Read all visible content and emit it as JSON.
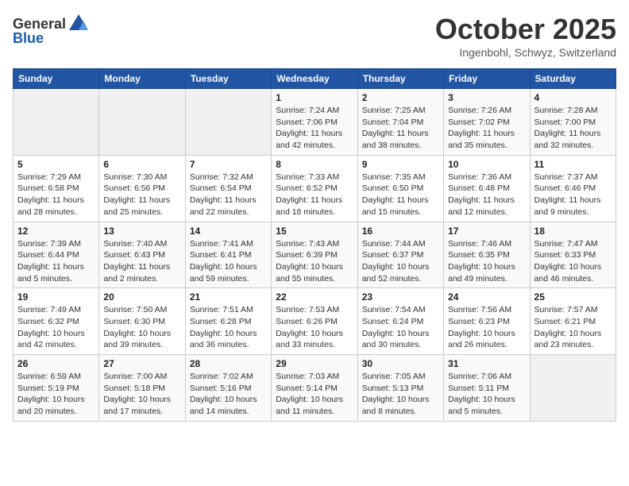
{
  "header": {
    "logo_general": "General",
    "logo_blue": "Blue",
    "title": "October 2025",
    "subtitle": "Ingenbohl, Schwyz, Switzerland"
  },
  "weekdays": [
    "Sunday",
    "Monday",
    "Tuesday",
    "Wednesday",
    "Thursday",
    "Friday",
    "Saturday"
  ],
  "weeks": [
    [
      {
        "day": "",
        "info": ""
      },
      {
        "day": "",
        "info": ""
      },
      {
        "day": "",
        "info": ""
      },
      {
        "day": "1",
        "info": "Sunrise: 7:24 AM\nSunset: 7:06 PM\nDaylight: 11 hours\nand 42 minutes."
      },
      {
        "day": "2",
        "info": "Sunrise: 7:25 AM\nSunset: 7:04 PM\nDaylight: 11 hours\nand 38 minutes."
      },
      {
        "day": "3",
        "info": "Sunrise: 7:26 AM\nSunset: 7:02 PM\nDaylight: 11 hours\nand 35 minutes."
      },
      {
        "day": "4",
        "info": "Sunrise: 7:28 AM\nSunset: 7:00 PM\nDaylight: 11 hours\nand 32 minutes."
      }
    ],
    [
      {
        "day": "5",
        "info": "Sunrise: 7:29 AM\nSunset: 6:58 PM\nDaylight: 11 hours\nand 28 minutes."
      },
      {
        "day": "6",
        "info": "Sunrise: 7:30 AM\nSunset: 6:56 PM\nDaylight: 11 hours\nand 25 minutes."
      },
      {
        "day": "7",
        "info": "Sunrise: 7:32 AM\nSunset: 6:54 PM\nDaylight: 11 hours\nand 22 minutes."
      },
      {
        "day": "8",
        "info": "Sunrise: 7:33 AM\nSunset: 6:52 PM\nDaylight: 11 hours\nand 18 minutes."
      },
      {
        "day": "9",
        "info": "Sunrise: 7:35 AM\nSunset: 6:50 PM\nDaylight: 11 hours\nand 15 minutes."
      },
      {
        "day": "10",
        "info": "Sunrise: 7:36 AM\nSunset: 6:48 PM\nDaylight: 11 hours\nand 12 minutes."
      },
      {
        "day": "11",
        "info": "Sunrise: 7:37 AM\nSunset: 6:46 PM\nDaylight: 11 hours\nand 9 minutes."
      }
    ],
    [
      {
        "day": "12",
        "info": "Sunrise: 7:39 AM\nSunset: 6:44 PM\nDaylight: 11 hours\nand 5 minutes."
      },
      {
        "day": "13",
        "info": "Sunrise: 7:40 AM\nSunset: 6:43 PM\nDaylight: 11 hours\nand 2 minutes."
      },
      {
        "day": "14",
        "info": "Sunrise: 7:41 AM\nSunset: 6:41 PM\nDaylight: 10 hours\nand 59 minutes."
      },
      {
        "day": "15",
        "info": "Sunrise: 7:43 AM\nSunset: 6:39 PM\nDaylight: 10 hours\nand 55 minutes."
      },
      {
        "day": "16",
        "info": "Sunrise: 7:44 AM\nSunset: 6:37 PM\nDaylight: 10 hours\nand 52 minutes."
      },
      {
        "day": "17",
        "info": "Sunrise: 7:46 AM\nSunset: 6:35 PM\nDaylight: 10 hours\nand 49 minutes."
      },
      {
        "day": "18",
        "info": "Sunrise: 7:47 AM\nSunset: 6:33 PM\nDaylight: 10 hours\nand 46 minutes."
      }
    ],
    [
      {
        "day": "19",
        "info": "Sunrise: 7:49 AM\nSunset: 6:32 PM\nDaylight: 10 hours\nand 42 minutes."
      },
      {
        "day": "20",
        "info": "Sunrise: 7:50 AM\nSunset: 6:30 PM\nDaylight: 10 hours\nand 39 minutes."
      },
      {
        "day": "21",
        "info": "Sunrise: 7:51 AM\nSunset: 6:28 PM\nDaylight: 10 hours\nand 36 minutes."
      },
      {
        "day": "22",
        "info": "Sunrise: 7:53 AM\nSunset: 6:26 PM\nDaylight: 10 hours\nand 33 minutes."
      },
      {
        "day": "23",
        "info": "Sunrise: 7:54 AM\nSunset: 6:24 PM\nDaylight: 10 hours\nand 30 minutes."
      },
      {
        "day": "24",
        "info": "Sunrise: 7:56 AM\nSunset: 6:23 PM\nDaylight: 10 hours\nand 26 minutes."
      },
      {
        "day": "25",
        "info": "Sunrise: 7:57 AM\nSunset: 6:21 PM\nDaylight: 10 hours\nand 23 minutes."
      }
    ],
    [
      {
        "day": "26",
        "info": "Sunrise: 6:59 AM\nSunset: 5:19 PM\nDaylight: 10 hours\nand 20 minutes."
      },
      {
        "day": "27",
        "info": "Sunrise: 7:00 AM\nSunset: 5:18 PM\nDaylight: 10 hours\nand 17 minutes."
      },
      {
        "day": "28",
        "info": "Sunrise: 7:02 AM\nSunset: 5:16 PM\nDaylight: 10 hours\nand 14 minutes."
      },
      {
        "day": "29",
        "info": "Sunrise: 7:03 AM\nSunset: 5:14 PM\nDaylight: 10 hours\nand 11 minutes."
      },
      {
        "day": "30",
        "info": "Sunrise: 7:05 AM\nSunset: 5:13 PM\nDaylight: 10 hours\nand 8 minutes."
      },
      {
        "day": "31",
        "info": "Sunrise: 7:06 AM\nSunset: 5:11 PM\nDaylight: 10 hours\nand 5 minutes."
      },
      {
        "day": "",
        "info": ""
      }
    ]
  ]
}
